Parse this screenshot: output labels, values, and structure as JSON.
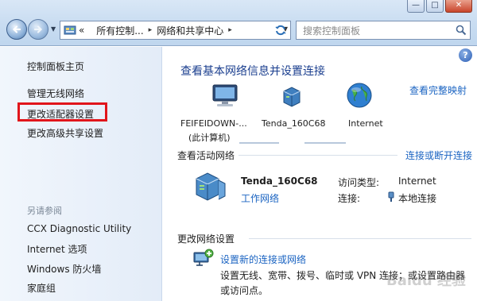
{
  "window": {
    "minimize": "—",
    "maximize": "□",
    "close": "✕"
  },
  "address": {
    "overflow": "«",
    "segments": [
      "所有控制...",
      "网络和共享中心"
    ]
  },
  "search": {
    "placeholder": "搜索控制面板"
  },
  "sidebar": {
    "home": "控制面板主页",
    "items": [
      "管理无线网络",
      "更改适配器设置",
      "更改高级共享设置"
    ],
    "see_also_header": "另请参阅",
    "see_also": [
      "CCX Diagnostic Utility",
      "Internet 选项",
      "Windows 防火墙",
      "家庭组"
    ]
  },
  "main": {
    "title": "查看基本网络信息并设置连接",
    "full_map": "查看完整映射",
    "map": {
      "computer_name": "FEIFEIDOWN-...",
      "computer_sub": "(此计算机)",
      "router": "Tenda_160C68",
      "internet": "Internet"
    },
    "active_header": "查看活动网络",
    "connect_link": "连接或断开连接",
    "network": {
      "name": "Tenda_160C68",
      "type": "工作网络",
      "access_key": "访问类型:",
      "access_val": "Internet",
      "conn_key": "连接:",
      "conn_val": "本地连接"
    },
    "change_header": "更改网络设置",
    "setup_link": "设置新的连接或网络",
    "setup_desc": "设置无线、宽带、拨号、临时或 VPN 连接；或设置路由器或访问点。"
  },
  "watermark": "Baidu 经验",
  "colors": {
    "accent": "#1b64c2",
    "title": "#1b3f8f",
    "highlight": "#e1151b"
  }
}
